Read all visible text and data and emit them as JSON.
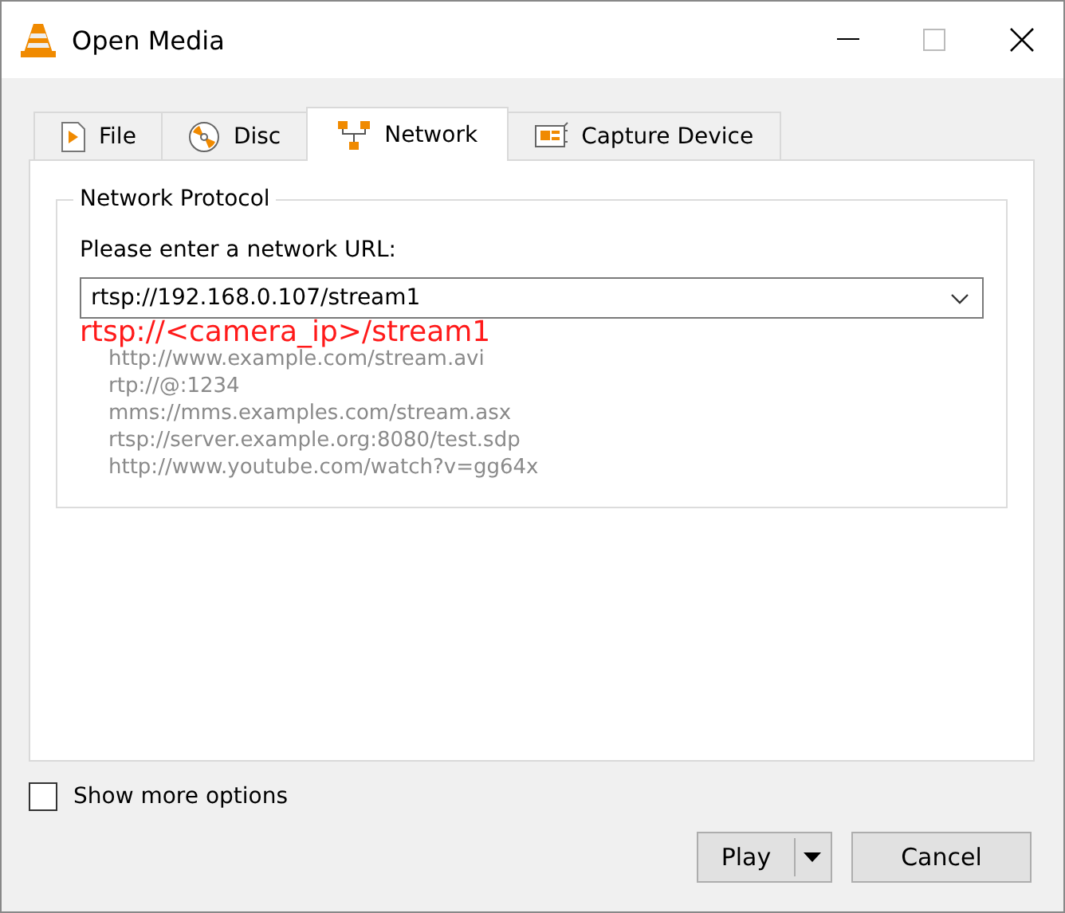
{
  "window": {
    "title": "Open Media"
  },
  "tabs": [
    {
      "label": "File",
      "kind": "file",
      "selected": false
    },
    {
      "label": "Disc",
      "kind": "disc",
      "selected": false
    },
    {
      "label": "Network",
      "kind": "network",
      "selected": true
    },
    {
      "label": "Capture Device",
      "kind": "capture",
      "selected": false
    }
  ],
  "group": {
    "title": "Network Protocol",
    "prompt": "Please enter a network URL:",
    "url_value": "rtsp://192.168.0.107/stream1",
    "annotation": "rtsp://<camera_ip>/stream1",
    "examples": [
      "http://www.example.com/stream.avi",
      "rtp://@:1234",
      "mms://mms.examples.com/stream.asx",
      "rtsp://server.example.org:8080/test.sdp",
      "http://www.youtube.com/watch?v=gg64x"
    ]
  },
  "show_more_options": {
    "label": "Show more options",
    "checked": false
  },
  "buttons": [
    {
      "label": "Play",
      "kind": "split"
    },
    {
      "label": "Cancel",
      "kind": "plain"
    }
  ]
}
